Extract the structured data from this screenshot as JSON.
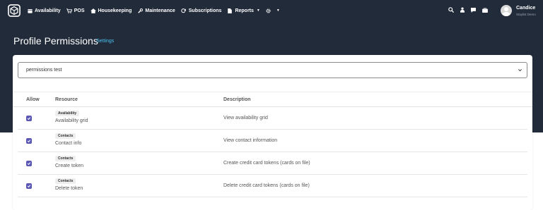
{
  "nav": {
    "items": [
      {
        "label": "Availability",
        "icon": "calendar-icon"
      },
      {
        "label": "POS",
        "icon": "cart-icon"
      },
      {
        "label": "Housekeeping",
        "icon": "house-icon"
      },
      {
        "label": "Maintenance",
        "icon": "wrench-icon"
      },
      {
        "label": "Subscriptions",
        "icon": "sync-icon"
      },
      {
        "label": "Reports",
        "icon": "document-icon"
      }
    ],
    "settings_icon": "gear-icon",
    "right_icons": [
      "search-icon",
      "user-icon",
      "chat-icon",
      "briefcase-icon"
    ]
  },
  "user": {
    "name": "Candice",
    "org": "Staylist Demo"
  },
  "header": {
    "title": "Profile Permissions",
    "settings_link": "Settings"
  },
  "profile_select": {
    "value": "permissions test"
  },
  "table": {
    "headers": {
      "allow": "Allow",
      "resource": "Resource",
      "description": "Description"
    },
    "rows": [
      {
        "allowed": true,
        "category": "Availability",
        "name": "Availability grid",
        "description": "View availability grid"
      },
      {
        "allowed": true,
        "category": "Contacts",
        "name": "Contact info",
        "description": "View contact information"
      },
      {
        "allowed": true,
        "category": "Contacts",
        "name": "Create token",
        "description": "Create credit card tokens (cards on file)"
      },
      {
        "allowed": true,
        "category": "Contacts",
        "name": "Delete token",
        "description": "Delete credit card tokens (cards on file)"
      }
    ]
  },
  "colors": {
    "header_bg": "#222b3a",
    "accent": "#4cc2f1",
    "checkbox": "#5b57b4"
  }
}
